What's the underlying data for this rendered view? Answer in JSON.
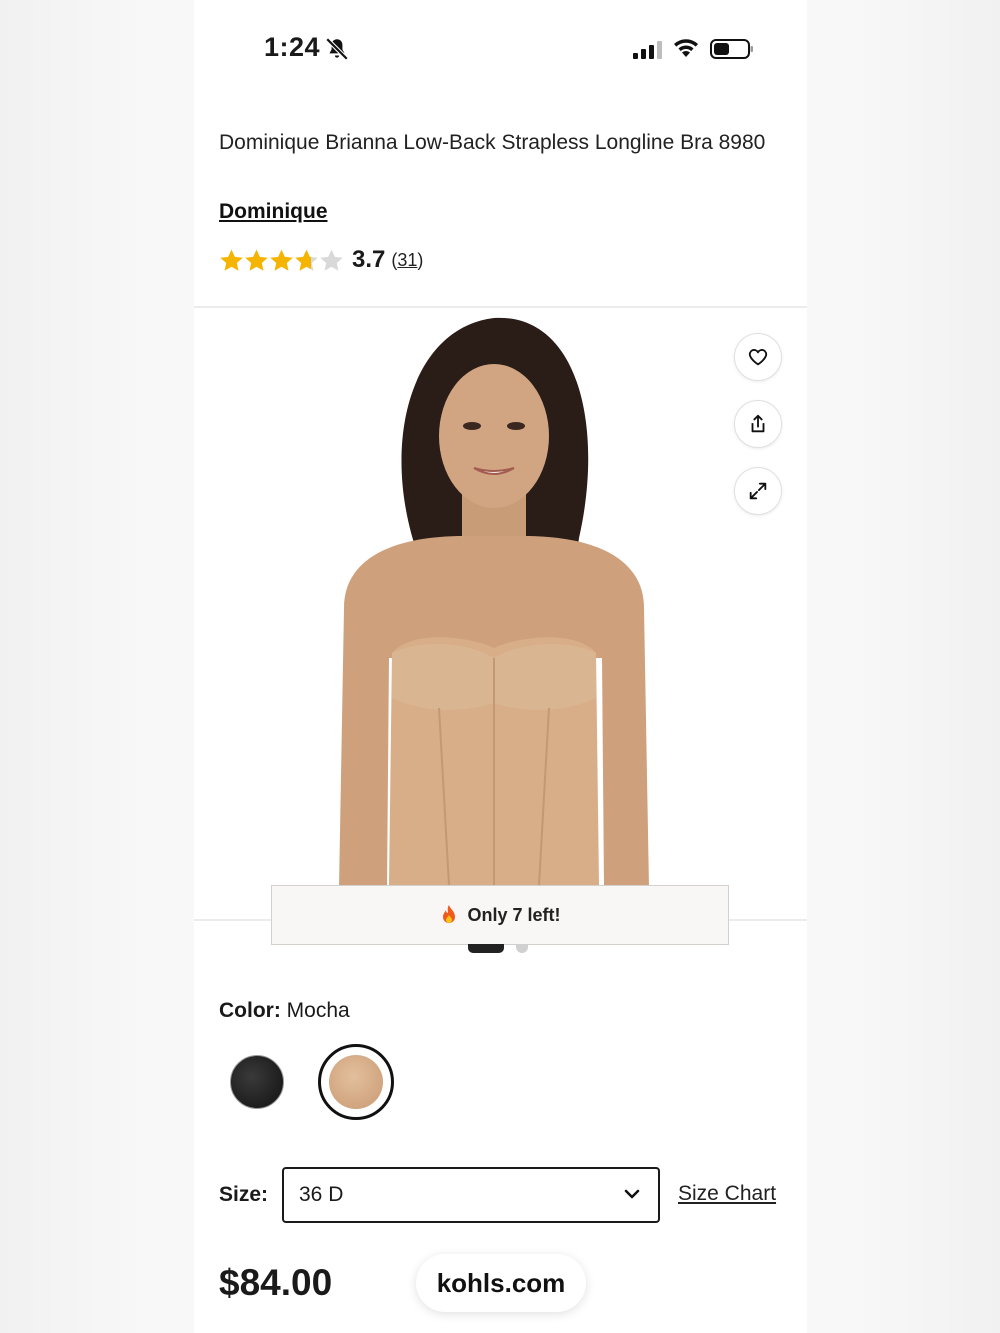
{
  "status_bar": {
    "time": "1:24",
    "icons": [
      "bell-off-icon",
      "signal-icon",
      "wifi-icon",
      "battery-icon"
    ]
  },
  "product": {
    "title": "Dominique Brianna Low-Back Strapless Longline Bra 8980",
    "brand": "Dominique",
    "rating": {
      "value": "3.7",
      "count_open": "(",
      "count": "31",
      "count_close": ")",
      "stars_filled": 3.7,
      "stars_max": 5,
      "star_color": "#f5b400"
    }
  },
  "gallery": {
    "actions": [
      "heart-icon",
      "share-icon",
      "expand-icon"
    ],
    "stock_notice": "Only 7 left!",
    "stock_icon": "fire-icon",
    "page_count": 2,
    "active_page": 1
  },
  "color": {
    "label": "Color:",
    "selected": "Mocha",
    "swatches": [
      {
        "name": "Black",
        "hex": "#222222"
      },
      {
        "name": "Mocha",
        "hex": "#d8ae88",
        "selected": true
      }
    ]
  },
  "size": {
    "label": "Size:",
    "value": "36 D",
    "chart_link": "Size Chart"
  },
  "price": "$84.00",
  "site": "kohls.com"
}
